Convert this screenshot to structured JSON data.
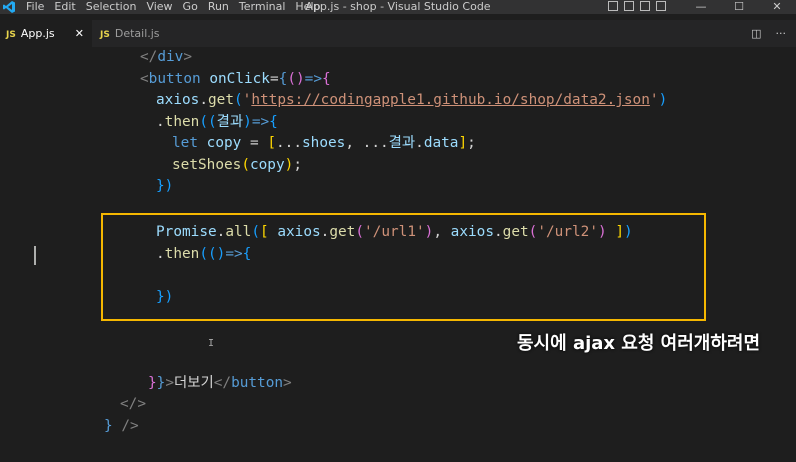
{
  "menu": [
    "File",
    "Edit",
    "Selection",
    "View",
    "Go",
    "Run",
    "Terminal",
    "Help"
  ],
  "window_title": "App.js - shop - Visual Studio Code",
  "window_controls": [
    "—",
    "☐",
    "✕"
  ],
  "tabs": [
    {
      "badge": "JS",
      "label": "App.js",
      "close": "✕"
    },
    {
      "badge": "JS",
      "label": "Detail.js"
    }
  ],
  "tab_actions": [
    "◫",
    "···"
  ],
  "code": {
    "l1": {
      "open": "</",
      "tag": "div",
      "close": ">"
    },
    "l2": {
      "lt": "<",
      "tag": "button",
      "attr": "onClick",
      "eq": "=",
      "b1": "{",
      "p1": "()",
      "arrow": "=>",
      "b2": "{"
    },
    "l3": {
      "obj": "axios",
      "dot": ".",
      "fn": "get",
      "p1": "(",
      "q1": "'",
      "url": "https://codingapple1.github.io/shop/data2.json",
      "q2": "'",
      "p2": ")"
    },
    "l4": {
      "dot": ".",
      "fn": "then",
      "p1": "((",
      "param": "결과",
      "p2": ")",
      "arrow": "=>",
      "b": "{"
    },
    "l5": {
      "kw": "let",
      "var": "copy",
      "eq": " = ",
      "b1": "[",
      "sp1": "...",
      "v1": "shoes",
      "comma": ", ",
      "sp2": "...",
      "v2": "결과",
      "dot": ".",
      "v3": "data",
      "b2": "]",
      "semi": ";"
    },
    "l6": {
      "fn": "setShoes",
      "p1": "(",
      "arg": "copy",
      "p2": ")",
      "semi": ";"
    },
    "l7": {
      "b": "}",
      "p": ")"
    },
    "l8": {
      "obj": "Promise",
      "dot": ".",
      "fn": "all",
      "p1": "(",
      "b1": "[",
      "a1": "axios",
      "d1": ".",
      "g1": "get",
      "q1": "(",
      "s1": "'/url1'",
      "q2": ")",
      "comma": ", ",
      "a2": "axios",
      "d2": ".",
      "g2": "get",
      "q3": "(",
      "s2": "'/url2'",
      "q4": ")",
      "b2": "]",
      "p2": ")"
    },
    "l9": {
      "dot": ".",
      "fn": "then",
      "p1": "((",
      "p2": ")",
      "arrow": "=>",
      "b": "{"
    },
    "l10": {
      "b": "}",
      "p": ")"
    },
    "l11": {
      "b1": "}",
      "b2": "}",
      "gt": ">",
      "text": "더보기",
      "open": "</",
      "tag": "button",
      "close": ">"
    },
    "l12": {
      "open": "</",
      "close": ">"
    },
    "l13": {
      "b": "}",
      "slash": " />"
    }
  },
  "caption": "동시에 ajax 요청 여러개하려면",
  "ibeam": "I"
}
